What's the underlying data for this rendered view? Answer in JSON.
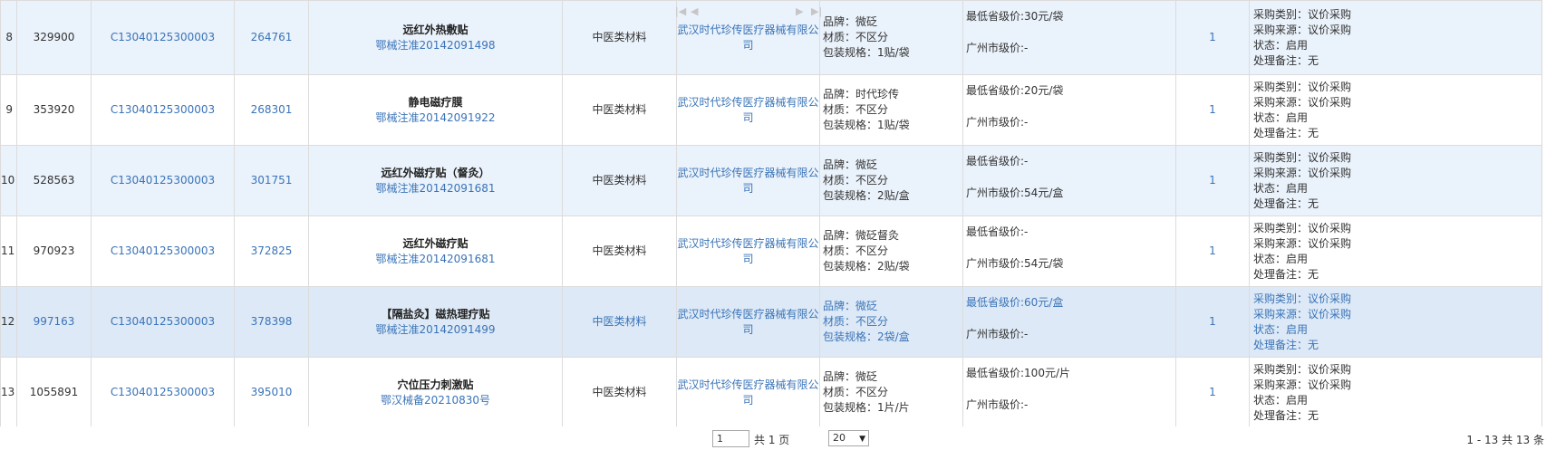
{
  "rows": [
    {
      "idx": "8",
      "id": "329900",
      "code": "C13040125300003",
      "num": "264761",
      "name": "远红外热敷贴",
      "reg": "鄂械注准20142091498",
      "category": "中医类材料",
      "company": "武汉时代珍传医疗器械有限公司",
      "brand": "品牌：微砭",
      "material": "材质：不区分",
      "pack": "包装规格：1贴/袋",
      "prov_price": "最低省级价:30元/袋",
      "gz_price": "广州市级价:-",
      "qty": "1",
      "p_type": "采购类别：议价采购",
      "p_source": "采购来源：议价采购",
      "p_status": "状态：启用",
      "p_note": "处理备注：无"
    },
    {
      "idx": "9",
      "id": "353920",
      "code": "C13040125300003",
      "num": "268301",
      "name": "静电磁疗膜",
      "reg": "鄂械注准20142091922",
      "category": "中医类材料",
      "company": "武汉时代珍传医疗器械有限公司",
      "brand": "品牌：时代珍传",
      "material": "材质：不区分",
      "pack": "包装规格：1贴/袋",
      "prov_price": "最低省级价:20元/袋",
      "gz_price": "广州市级价:-",
      "qty": "1",
      "p_type": "采购类别：议价采购",
      "p_source": "采购来源：议价采购",
      "p_status": "状态：启用",
      "p_note": "处理备注：无"
    },
    {
      "idx": "10",
      "id": "528563",
      "code": "C13040125300003",
      "num": "301751",
      "name": "远红外磁疗贴（督灸）",
      "reg": "鄂械注准20142091681",
      "category": "中医类材料",
      "company": "武汉时代珍传医疗器械有限公司",
      "brand": "品牌：微砭",
      "material": "材质：不区分",
      "pack": "包装规格：2贴/盒",
      "prov_price": "最低省级价:-",
      "gz_price": "广州市级价:54元/盒",
      "qty": "1",
      "p_type": "采购类别：议价采购",
      "p_source": "采购来源：议价采购",
      "p_status": "状态：启用",
      "p_note": "处理备注：无"
    },
    {
      "idx": "11",
      "id": "970923",
      "code": "C13040125300003",
      "num": "372825",
      "name": "远红外磁疗贴",
      "reg": "鄂械注准20142091681",
      "category": "中医类材料",
      "company": "武汉时代珍传医疗器械有限公司",
      "brand": "品牌：微砭督灸",
      "material": "材质：不区分",
      "pack": "包装规格：2贴/袋",
      "prov_price": "最低省级价:-",
      "gz_price": "广州市级价:54元/袋",
      "qty": "1",
      "p_type": "采购类别：议价采购",
      "p_source": "采购来源：议价采购",
      "p_status": "状态：启用",
      "p_note": "处理备注：无"
    },
    {
      "idx": "12",
      "id": "997163",
      "code": "C13040125300003",
      "num": "378398",
      "name": "【隔盐灸】磁热理疗贴",
      "reg": "鄂械注准20142091499",
      "category": "中医类材料",
      "company": "武汉时代珍传医疗器械有限公司",
      "brand": "品牌：微砭",
      "material": "材质：不区分",
      "pack": "包装规格：2袋/盒",
      "prov_price": "最低省级价:60元/盒",
      "gz_price": "广州市级价:-",
      "qty": "1",
      "p_type": "采购类别：议价采购",
      "p_source": "采购来源：议价采购",
      "p_status": "状态：启用",
      "p_note": "处理备注：无"
    },
    {
      "idx": "13",
      "id": "1055891",
      "code": "C13040125300003",
      "num": "395010",
      "name": "穴位压力刺激贴",
      "reg": "鄂汉械备20210830号",
      "category": "中医类材料",
      "company": "武汉时代珍传医疗器械有限公司",
      "brand": "品牌：微砭",
      "material": "材质：不区分",
      "pack": "包装规格：1片/片",
      "prov_price": "最低省级价:100元/片",
      "gz_price": "广州市级价:-",
      "qty": "1",
      "p_type": "采购类别：议价采购",
      "p_source": "采购来源：议价采购",
      "p_status": "状态：启用",
      "p_note": "处理备注：无"
    }
  ],
  "pager": {
    "first_icon": "first-page-icon",
    "prev_icon": "prev-page-icon",
    "next_icon": "next-page-icon",
    "last_icon": "last-page-icon",
    "page_value": "1",
    "total_pages_text": "共 1 页",
    "page_size": "20",
    "range_text": "1 - 13   共 13 条"
  },
  "colors": {
    "link": "#3a74b8",
    "alt_row": "#eaf2fb",
    "selected_row": "#dde9f6",
    "border": "#dcdcdc"
  }
}
